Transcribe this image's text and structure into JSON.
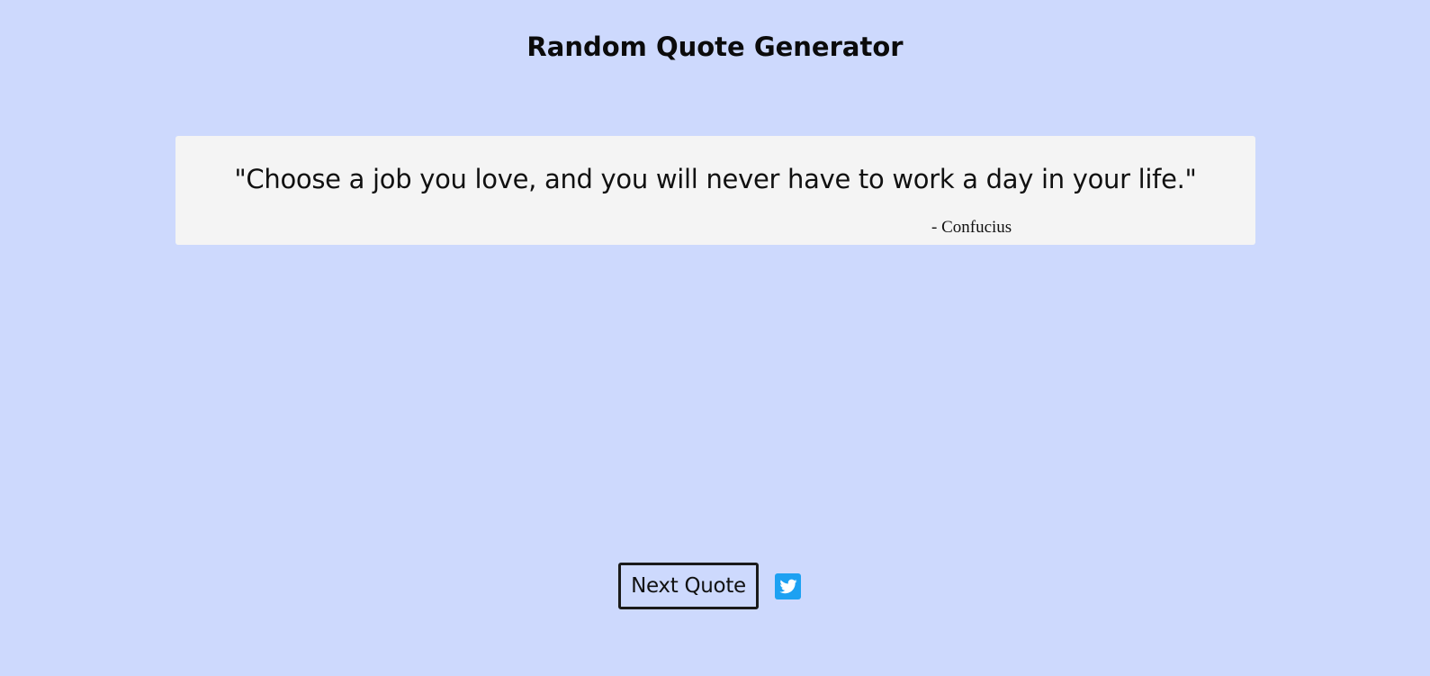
{
  "header": {
    "title": "Random Quote Generator"
  },
  "quote": {
    "text": "\"Choose a job you love, and you will never have to work a day in your life.\"",
    "author": "- Confucius"
  },
  "actions": {
    "next_label": "Next Quote",
    "share_icon": "twitter-icon"
  },
  "colors": {
    "background": "#cdd9fd",
    "card": "#f4f4f4",
    "twitter": "#1da1f2"
  }
}
